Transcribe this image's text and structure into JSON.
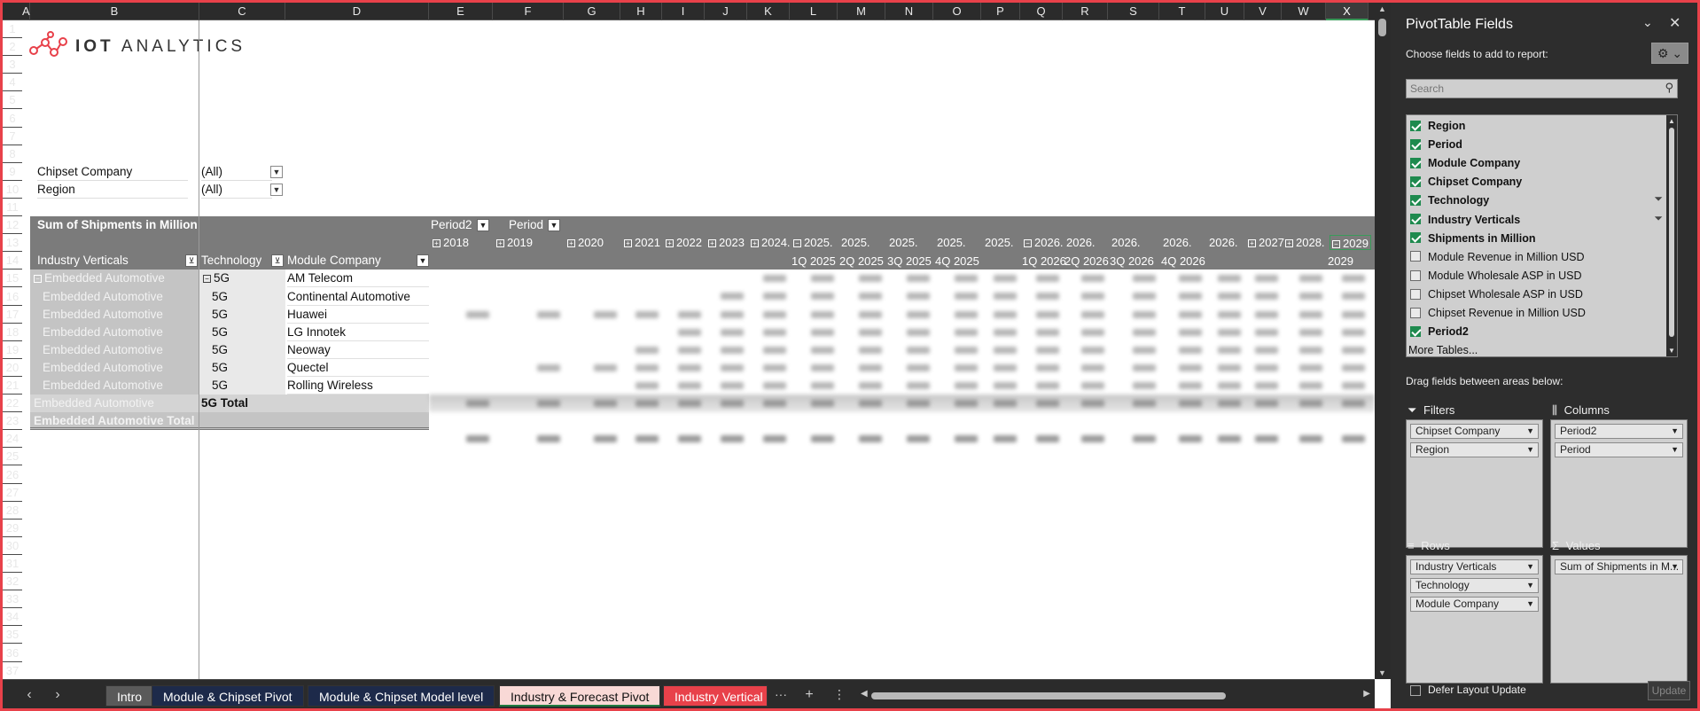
{
  "columns": [
    "A",
    "B",
    "C",
    "D",
    "E",
    "F",
    "G",
    "H",
    "I",
    "J",
    "K",
    "L",
    "M",
    "N",
    "O",
    "P",
    "Q",
    "R",
    "S",
    "T",
    "U",
    "V",
    "W",
    "X"
  ],
  "rows": [
    "1",
    "2",
    "3",
    "4",
    "5",
    "6",
    "7",
    "8",
    "9",
    "10",
    "11",
    "12",
    "13",
    "14",
    "15",
    "16",
    "17",
    "18",
    "19",
    "20",
    "21",
    "22",
    "23",
    "24",
    "25",
    "26",
    "27",
    "28",
    "29",
    "30",
    "31",
    "32",
    "33",
    "34",
    "35",
    "36",
    "37"
  ],
  "logo": {
    "text_bold": "IOT",
    "text": "ANALYTICS"
  },
  "filters": [
    {
      "label": "Chipset Company",
      "value": "(All)"
    },
    {
      "label": "Region",
      "value": "(All)"
    }
  ],
  "pivot": {
    "value_label": "Sum of Shipments in Million",
    "period2_label": "Period2",
    "period_label": "Period",
    "years": [
      "2018",
      "2019",
      "2020",
      "2021",
      "2022",
      "2023",
      "2024.",
      "2025.",
      "2025.",
      "2025.",
      "2025.",
      "2025.",
      "2026.",
      "2026.",
      "2026.",
      "2026.",
      "2026.",
      "2027",
      "2028.",
      "2029"
    ],
    "quarters": [
      "1Q 2025",
      "2Q 2025",
      "3Q 2025",
      "4Q 2025",
      "1Q 2026",
      "2Q 2026",
      "3Q 2026",
      "4Q 2026",
      "2029"
    ],
    "row_headers": {
      "industry": "Industry Verticals",
      "technology": "Technology",
      "module": "Module Company"
    },
    "rows": [
      {
        "industry": "Embedded Automotive",
        "technology": "5G",
        "module": "AM Telecom"
      },
      {
        "industry": "Embedded Automotive",
        "technology": "5G",
        "module": "Continental Automotive"
      },
      {
        "industry": "Embedded Automotive",
        "technology": "5G",
        "module": "Huawei"
      },
      {
        "industry": "Embedded Automotive",
        "technology": "5G",
        "module": "LG Innotek"
      },
      {
        "industry": "Embedded Automotive",
        "technology": "5G",
        "module": "Neoway"
      },
      {
        "industry": "Embedded Automotive",
        "technology": "5G",
        "module": "Quectel"
      },
      {
        "industry": "Embedded Automotive",
        "technology": "5G",
        "module": "Rolling Wireless"
      }
    ],
    "subtotal": {
      "industry": "Embedded Automotive",
      "technology": "5G Total"
    },
    "grand_total": "Embedded Automotive Total"
  },
  "tabs": {
    "items": [
      {
        "label": "Intro"
      },
      {
        "label": "Module & Chipset Pivot"
      },
      {
        "label": "Module & Chipset Model level"
      },
      {
        "label": "Industry & Forecast Pivot"
      },
      {
        "label": "Industry Vertical &"
      }
    ],
    "more": "···",
    "add": "+",
    "options": "⋮"
  },
  "pane": {
    "title": "PivotTable Fields",
    "subtitle": "Choose fields to add to report:",
    "search_placeholder": "Search",
    "fields": [
      {
        "label": "Region",
        "checked": true,
        "filter": false
      },
      {
        "label": "Period",
        "checked": true,
        "filter": false
      },
      {
        "label": "Module Company",
        "checked": true,
        "filter": false
      },
      {
        "label": "Chipset Company",
        "checked": true,
        "filter": false
      },
      {
        "label": "Technology",
        "checked": true,
        "filter": true
      },
      {
        "label": "Industry Verticals",
        "checked": true,
        "filter": true
      },
      {
        "label": "Shipments in Million",
        "checked": true,
        "filter": false
      },
      {
        "label": "Module Revenue in Million USD",
        "checked": false,
        "filter": false
      },
      {
        "label": "Module Wholesale ASP in USD",
        "checked": false,
        "filter": false
      },
      {
        "label": "Chipset Wholesale ASP in USD",
        "checked": false,
        "filter": false
      },
      {
        "label": "Chipset Revenue in Million USD",
        "checked": false,
        "filter": false
      },
      {
        "label": "Period2",
        "checked": true,
        "filter": false
      }
    ],
    "more_tables": "More Tables...",
    "drag_hint": "Drag fields between areas below:",
    "areas": {
      "filters": {
        "title": "Filters",
        "items": [
          "Chipset Company",
          "Region"
        ]
      },
      "columns": {
        "title": "Columns",
        "items": [
          "Period2",
          "Period"
        ]
      },
      "rows": {
        "title": "Rows",
        "items": [
          "Industry Verticals",
          "Technology",
          "Module Company"
        ]
      },
      "values": {
        "title": "Values",
        "items": [
          "Sum of Shipments in M..."
        ]
      }
    },
    "defer_label": "Defer Layout Update",
    "update_label": "Update"
  }
}
